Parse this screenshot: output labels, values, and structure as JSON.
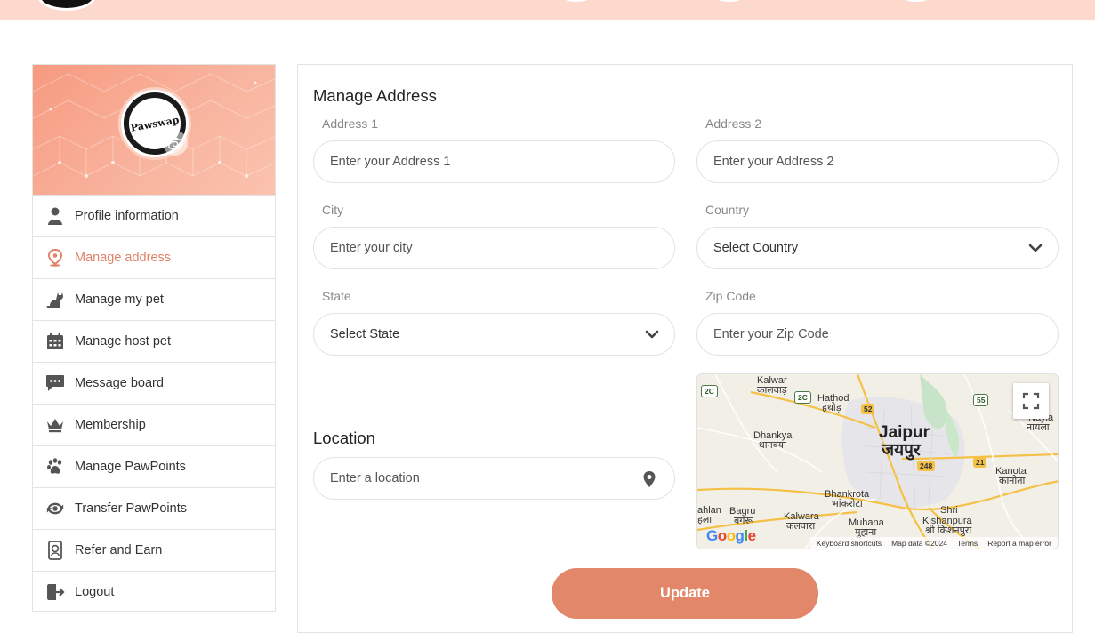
{
  "colors": {
    "accent": "#e2876a",
    "active_menu": "#e0826a",
    "topbar": "#fcd9cc",
    "banner": "#f8b39d"
  },
  "profile": {
    "avatar_text": "Pawswap"
  },
  "sidebar": {
    "items": [
      {
        "label": "Profile information",
        "icon": "user-icon"
      },
      {
        "label": "Manage address",
        "icon": "location-pin-icon",
        "active": true
      },
      {
        "label": "Manage my pet",
        "icon": "cat-icon"
      },
      {
        "label": "Manage host pet",
        "icon": "calendar-icon"
      },
      {
        "label": "Message board",
        "icon": "chat-bubble-icon"
      },
      {
        "label": "Membership",
        "icon": "crown-icon"
      },
      {
        "label": "Manage PawPoints",
        "icon": "paw-icon"
      },
      {
        "label": "Transfer PawPoints",
        "icon": "transfer-icon"
      },
      {
        "label": "Refer and Earn",
        "icon": "refer-icon"
      },
      {
        "label": "Logout",
        "icon": "logout-icon"
      }
    ]
  },
  "form": {
    "title": "Manage Address",
    "address1": {
      "label": "Address 1",
      "placeholder": "Enter your Address 1"
    },
    "address2": {
      "label": "Address 2",
      "placeholder": "Enter your Address 2"
    },
    "city": {
      "label": "City",
      "placeholder": "Enter your city"
    },
    "country": {
      "label": "Country",
      "value": "Select Country"
    },
    "state": {
      "label": "State",
      "value": "Select State"
    },
    "zip": {
      "label": "Zip Code",
      "placeholder": "Enter your Zip Code"
    },
    "location_title": "Location",
    "location": {
      "placeholder": "Enter a location"
    },
    "update_label": "Update"
  },
  "map": {
    "places": {
      "kalwar": "Kalwar",
      "kalwar_hi": "कालवाड़",
      "hathod": "Hathod",
      "hathod_hi": "हथोड़",
      "dhankya": "Dhankya",
      "dhankya_hi": "धानक्या",
      "jaipur": "Jaipur",
      "jaipur_hi": "जयपुर",
      "nayla": "Nayla",
      "nayla_hi": "नायला",
      "kanota": "Kanota",
      "kanota_hi": "कानोता",
      "bhankrota": "Bhankrota",
      "bhankrota_hi": "भांकरोटा",
      "bagru": "Bagru",
      "bagru_hi": "बगरू",
      "kalwara": "Kalwara",
      "kalwara_hi": "कलवारा",
      "muhana": "Muhana",
      "muhana_hi": "मुहाना",
      "shri": "Shri",
      "kishanpura": "Kishanpura",
      "kishanpura_hi": "श्री किशनपुरा",
      "ahlan": "ahlan",
      "ahlan_hi": "हला"
    },
    "shields": {
      "s2c_a": "2C",
      "s2c_b": "2C",
      "s52": "52",
      "s55": "55",
      "s248": "248",
      "s21": "21"
    },
    "google": "Google",
    "attribution": {
      "shortcuts": "Keyboard shortcuts",
      "data": "Map data ©2024",
      "terms": "Terms",
      "report": "Report a map error"
    }
  }
}
